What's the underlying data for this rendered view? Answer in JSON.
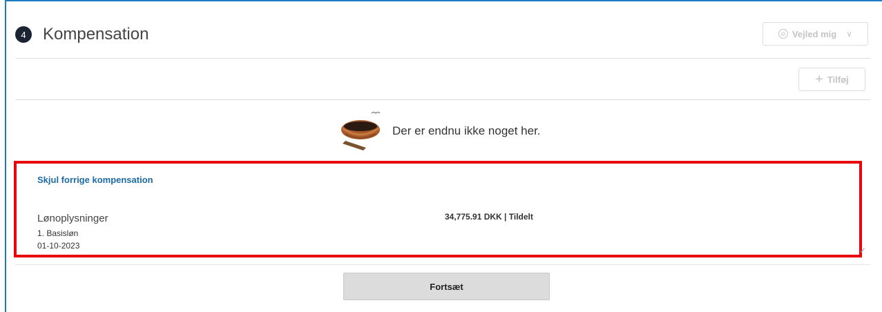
{
  "section": {
    "step_number": "4",
    "title": "Kompensation"
  },
  "toolbar": {
    "guide_label": "Vejled mig",
    "add_label": "Tilføj"
  },
  "empty_state": {
    "message": "Der er endnu ikke noget her."
  },
  "previous_compensation": {
    "toggle_label": "Skjul forrige kompensation",
    "record": {
      "title": "Lønoplysninger",
      "subtitle": "1. Basisløn",
      "date": "01-10-2023",
      "amount": "34,775.91 DKK | Tildelt"
    }
  },
  "footer": {
    "continue_label": "Fortsæt"
  },
  "colors": {
    "accent": "#1f7bc1",
    "link": "#1b6aa5",
    "highlight": "#e8000b",
    "badge": "#1c2433"
  }
}
